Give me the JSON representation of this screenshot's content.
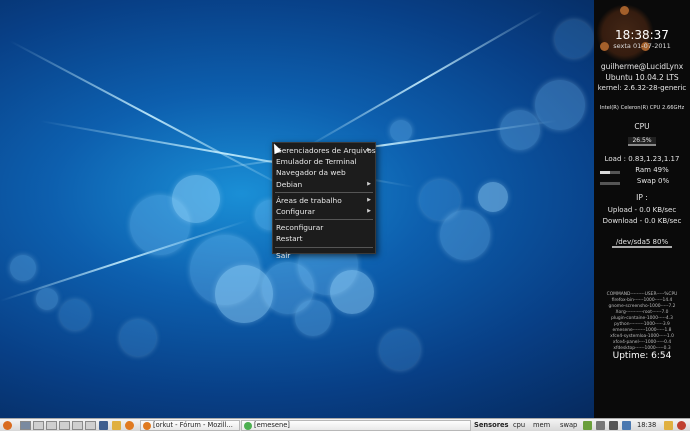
{
  "context_menu": {
    "items": [
      {
        "label": "Gerenciadores de Arquivos",
        "submenu": true
      },
      {
        "label": "Emulador de Terminal",
        "submenu": false
      },
      {
        "label": "Navegador da web",
        "submenu": false
      },
      {
        "label": "Debian",
        "submenu": true
      },
      {
        "label": "Áreas de trabalho",
        "submenu": true
      },
      {
        "label": "Configurar",
        "submenu": true
      },
      {
        "label": "Reconfigurar",
        "submenu": false
      },
      {
        "label": "Restart",
        "submenu": false
      },
      {
        "label": "Sair",
        "submenu": false
      }
    ],
    "arrow_glyph": "▶"
  },
  "conky": {
    "time": "18:38:37",
    "date": "sexta 01-07-2011",
    "user": "guilherme@LucidLynx",
    "distro": "Ubuntu 10.04.2 LTS",
    "kernel": "kernel: 2.6.32-28-generic",
    "cpu_model": "Intel(R) Celeron(R) CPU 2.66GHz",
    "cpu_label": "CPU",
    "cpu_percent": "26.5%",
    "cpu_fraction": 0.265,
    "load": "Load : 0.83,1.23,1.17",
    "ram": "Ram 49%",
    "ram_fraction": 0.49,
    "swap": "Swap 0%",
    "swap_fraction": 0.0,
    "ip_label": "IP :",
    "upload": "Upload - 0.0 KB/sec",
    "download": "Download - 0.0 KB/sec",
    "disk": "/dev/sda5 80%",
    "disk_fraction": 0.8,
    "proc_header": "COMMAND---------USER-----%CPU",
    "procs": [
      "firefox-bin------1000-----14.4",
      "gnome-screensho-1000-----7.2",
      "Xorg-----------root------7.0",
      "plugin-containe-1000-----4.3",
      "python---------1000-----3.9",
      "emesene--------1000-----1.8",
      "xfce4-systemloa-1000-----1.0",
      "xfce4-panel----1000-----0.4",
      "xfdesktop------1000-----0.3"
    ],
    "uptime": "Uptime: 6:54"
  },
  "panel": {
    "tasks": [
      {
        "label": "[orkut - Fórum - Mozill...",
        "icon_color": "#e07a20"
      },
      {
        "label": "[emesene]",
        "icon_color": "#4caf50"
      }
    ],
    "monitors": [
      "Sensores",
      "cpu",
      "mem",
      "swap"
    ],
    "clock": "18:38"
  },
  "colors": {
    "menu_bg": "#1c1c1c",
    "panel_bg": "#e6e6e6",
    "conky_bg": "#0a0a0a",
    "wallpaper": "#0d5fae"
  }
}
